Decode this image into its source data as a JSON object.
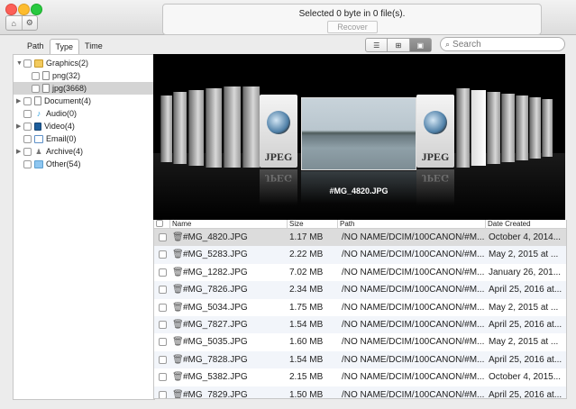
{
  "toolbar": {
    "status": "Selected 0 byte in 0 file(s).",
    "recover_label": "Recover",
    "home_icon": "home-icon",
    "settings_icon": "gear-icon"
  },
  "tabs": [
    {
      "label": "Path"
    },
    {
      "label": "Type"
    },
    {
      "label": "Time"
    }
  ],
  "search": {
    "placeholder": "Search"
  },
  "sidebar": {
    "items": [
      {
        "label": "Graphics(2)",
        "icon": "folder-icon"
      },
      {
        "label": "png(32)",
        "icon": "file-icon"
      },
      {
        "label": "jpg(3668)",
        "icon": "file-icon"
      },
      {
        "label": "Document(4)",
        "icon": "document-icon"
      },
      {
        "label": "Audio(0)",
        "icon": "music-note-icon"
      },
      {
        "label": "Video(4)",
        "icon": "film-icon"
      },
      {
        "label": "Email(0)",
        "icon": "envelope-icon"
      },
      {
        "label": "Archive(4)",
        "icon": "archive-icon"
      },
      {
        "label": "Other(54)",
        "icon": "folder-icon"
      }
    ]
  },
  "preview": {
    "caption": "#MG_4820.JPG",
    "card_label": "JPEG",
    "card_label_mirror": "JPEG"
  },
  "table": {
    "headers": {
      "name": "Name",
      "size": "Size",
      "path": "Path",
      "date": "Date Created"
    },
    "rows": [
      {
        "name": "#MG_4820.JPG",
        "size": "1.17 MB",
        "path": "/NO NAME/DCIM/100CANON/#M...",
        "date": "October 4, 2014..."
      },
      {
        "name": "#MG_5283.JPG",
        "size": "2.22 MB",
        "path": "/NO NAME/DCIM/100CANON/#M...",
        "date": "May 2, 2015 at ..."
      },
      {
        "name": "#MG_1282.JPG",
        "size": "7.02 MB",
        "path": "/NO NAME/DCIM/100CANON/#M...",
        "date": "January 26, 201..."
      },
      {
        "name": "#MG_7826.JPG",
        "size": "2.34 MB",
        "path": "/NO NAME/DCIM/100CANON/#M...",
        "date": "April 25, 2016 at..."
      },
      {
        "name": "#MG_5034.JPG",
        "size": "1.75 MB",
        "path": "/NO NAME/DCIM/100CANON/#M...",
        "date": "May 2, 2015 at ..."
      },
      {
        "name": "#MG_7827.JPG",
        "size": "1.54 MB",
        "path": "/NO NAME/DCIM/100CANON/#M...",
        "date": "April 25, 2016 at..."
      },
      {
        "name": "#MG_5035.JPG",
        "size": "1.60 MB",
        "path": "/NO NAME/DCIM/100CANON/#M...",
        "date": "May 2, 2015 at ..."
      },
      {
        "name": "#MG_7828.JPG",
        "size": "1.54 MB",
        "path": "/NO NAME/DCIM/100CANON/#M...",
        "date": "April 25, 2016 at..."
      },
      {
        "name": "#MG_5382.JPG",
        "size": "2.15 MB",
        "path": "/NO NAME/DCIM/100CANON/#M...",
        "date": "October 4, 2015..."
      },
      {
        "name": "#MG_7829.JPG",
        "size": "1.50 MB",
        "path": "/NO NAME/DCIM/100CANON/#M...",
        "date": "April 25, 2016 at..."
      }
    ]
  },
  "colors": {
    "selected_row": "#dcdcdc",
    "alt_row": "#f2f5fa",
    "preview_bg": "#000000"
  }
}
